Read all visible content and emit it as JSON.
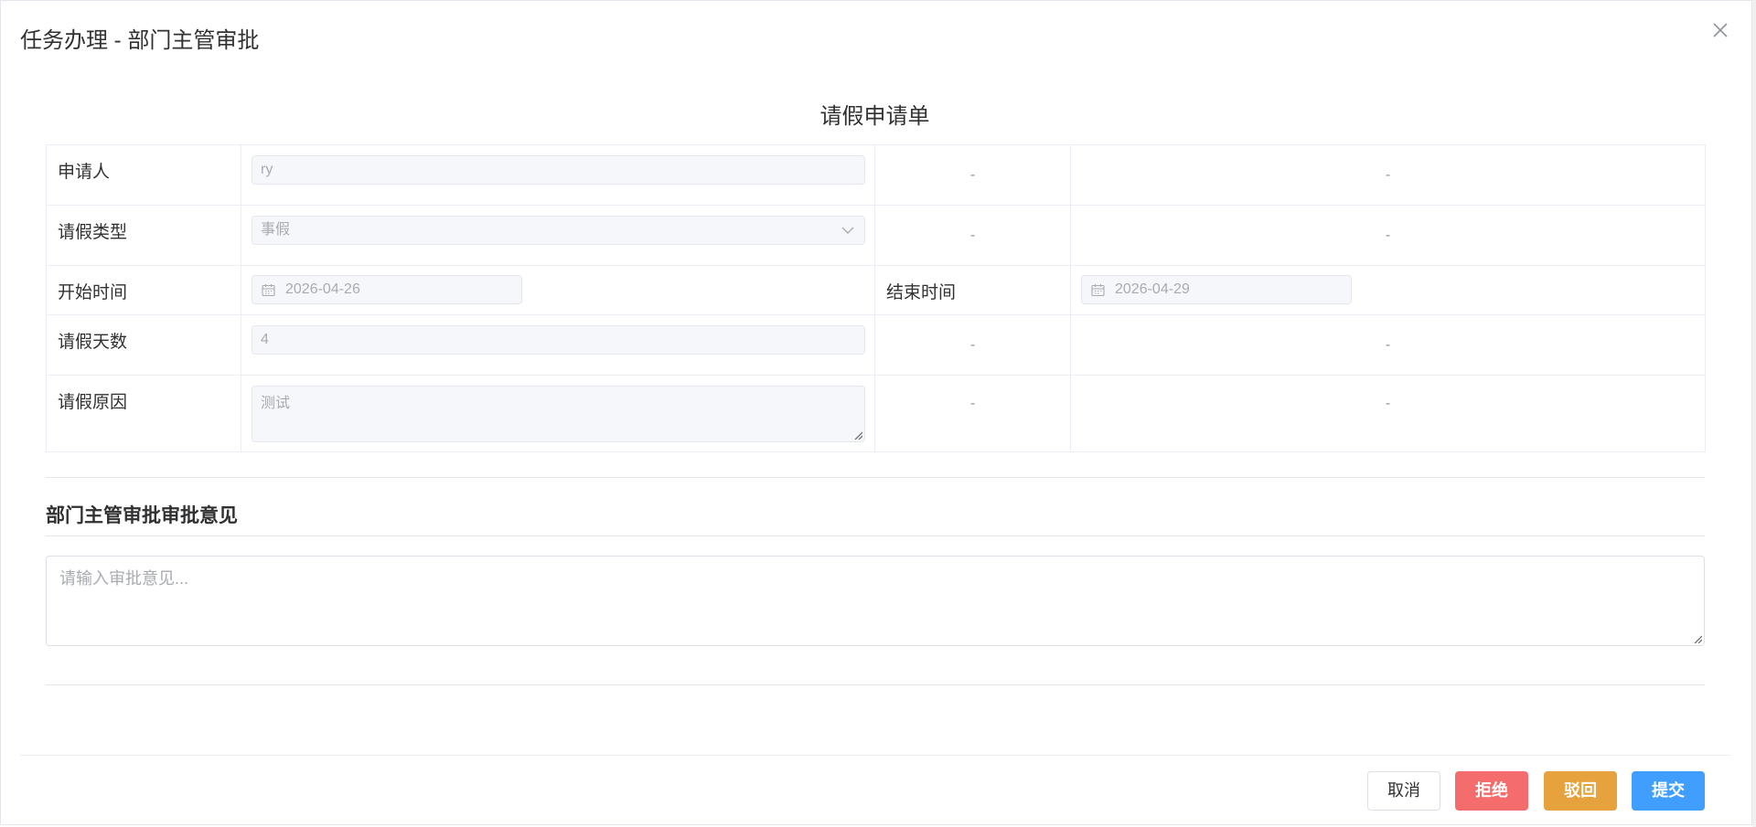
{
  "dialog": {
    "title": "任务办理 - 部门主管审批"
  },
  "form": {
    "title": "请假申请单",
    "placeholder_dash": "-",
    "rows": [
      {
        "label": "申请人",
        "value": "ry"
      },
      {
        "label": "请假类型",
        "value": "事假"
      },
      {
        "label": "开始时间",
        "value": "2026-04-26",
        "extra_label": "结束时间",
        "extra_value": "2026-04-29"
      },
      {
        "label": "请假天数",
        "value": "4"
      },
      {
        "label": "请假原因",
        "value": "测试"
      }
    ]
  },
  "opinion": {
    "section_title": "部门主管审批审批意见",
    "placeholder": "请输入审批意见..."
  },
  "footer": {
    "cancel_label": "取消",
    "reject_label": "拒绝",
    "return_label": "驳回",
    "submit_label": "提交"
  },
  "colors": {
    "reject": "#f56c6c",
    "return": "#e6a23c",
    "submit": "#409eff"
  }
}
